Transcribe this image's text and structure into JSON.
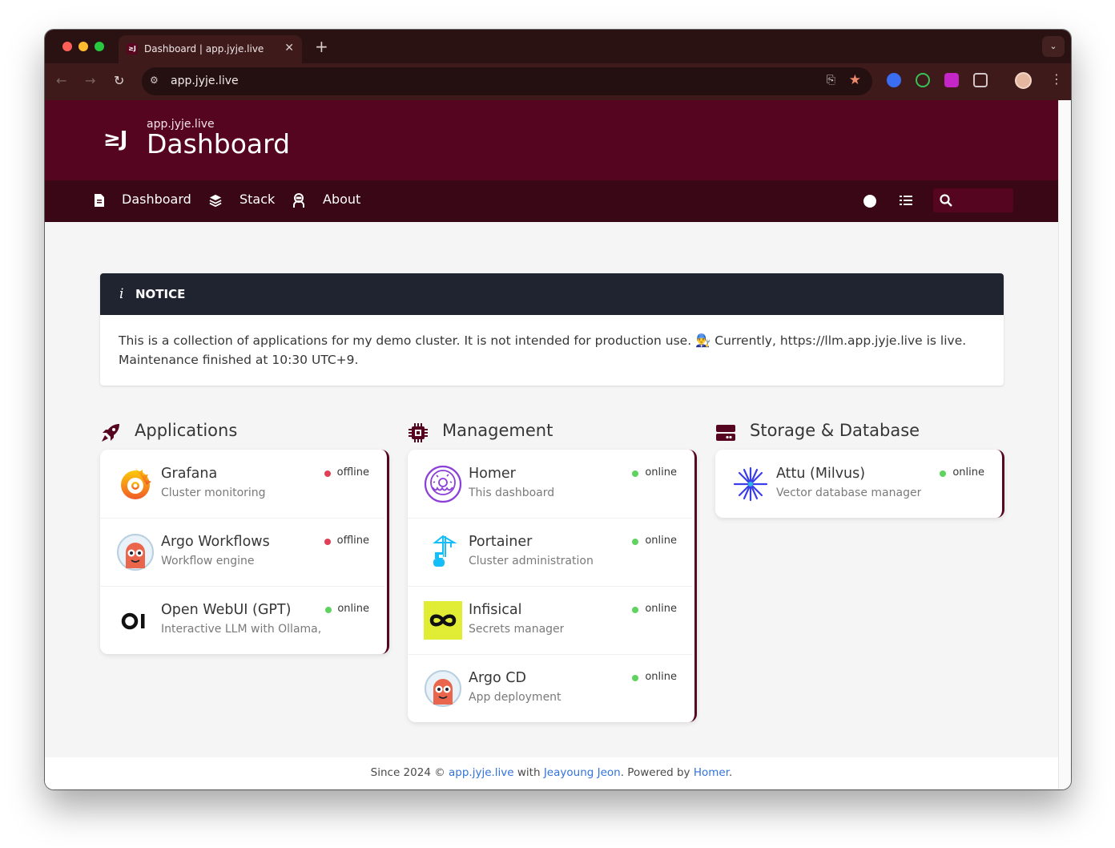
{
  "browser": {
    "tab_title": "Dashboard | app.jyje.live",
    "tab_favicon": "≥J",
    "url": "app.jyje.live",
    "icons": [
      "back-icon",
      "forward-icon",
      "reload-icon",
      "site-settings-icon",
      "install-icon",
      "bookmark-star-icon",
      "extension-icon",
      "profile-avatar",
      "menu-icon"
    ]
  },
  "header": {
    "logo": "≥J",
    "subtitle": "app.jyje.live",
    "title": "Dashboard"
  },
  "nav": {
    "items": [
      {
        "label": "Dashboard",
        "icon": "file-icon"
      },
      {
        "label": "Stack",
        "icon": "layers-icon"
      },
      {
        "label": "About",
        "icon": "user-astronaut-icon"
      }
    ]
  },
  "notice": {
    "icon": "i",
    "title": "NOTICE",
    "body": "This is a collection of applications for my demo cluster. It is not intended for production use. 👨‍🔧 Currently, https://llm.app.jyje.live is live. Maintenance finished at 10:30 UTC+9."
  },
  "columns": [
    {
      "title": "Applications",
      "icon": "rocket-icon",
      "services": [
        {
          "name": "Grafana",
          "subtitle": "Cluster monitoring",
          "status": "offline"
        },
        {
          "name": "Argo Workflows",
          "subtitle": "Workflow engine",
          "status": "offline"
        },
        {
          "name": "Open WebUI (GPT)",
          "subtitle": "Interactive LLM with Ollama, ...",
          "status": "online"
        }
      ]
    },
    {
      "title": "Management",
      "icon": "chip-icon",
      "services": [
        {
          "name": "Homer",
          "subtitle": "This dashboard",
          "status": "online"
        },
        {
          "name": "Portainer",
          "subtitle": "Cluster administration",
          "status": "online"
        },
        {
          "name": "Infisical",
          "subtitle": "Secrets manager",
          "status": "online"
        },
        {
          "name": "Argo CD",
          "subtitle": "App deployment",
          "status": "online"
        }
      ]
    },
    {
      "title": "Storage & Database",
      "icon": "server-icon",
      "services": [
        {
          "name": "Attu (Milvus)",
          "subtitle": "Vector database manager",
          "status": "online"
        }
      ]
    }
  ],
  "footer": {
    "prefix": "Since 2024 © ",
    "site": "app.jyje.live",
    "with": " with ",
    "author": "Jeayoung Jeon",
    "powered": ". Powered by ",
    "engine": "Homer",
    "suffix": "."
  },
  "colors": {
    "primary": "#560521",
    "nav": "#3a0717",
    "online": "#5fd35f",
    "offline": "#e23e55"
  }
}
